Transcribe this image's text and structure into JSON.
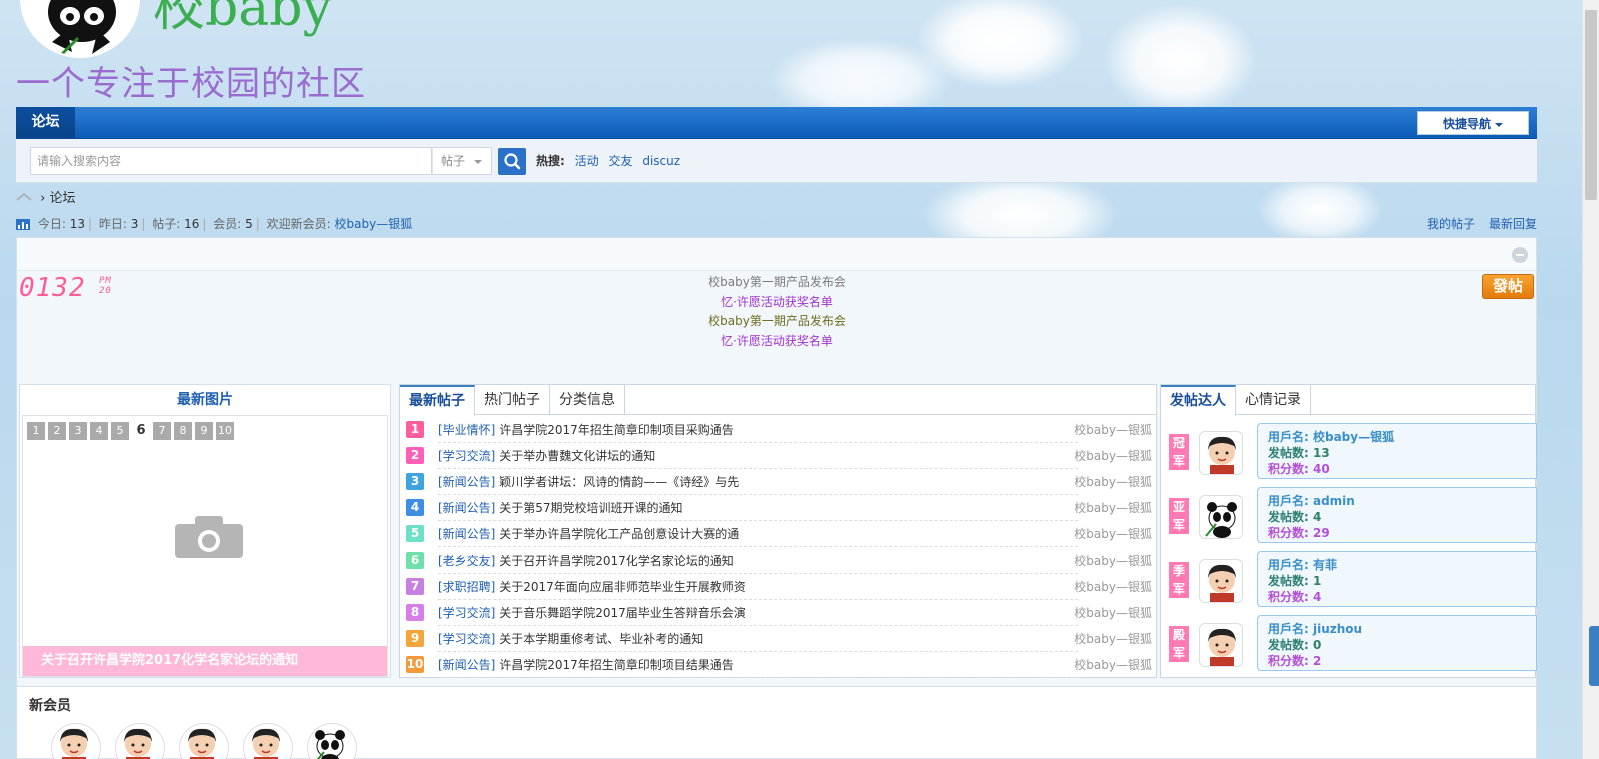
{
  "brand": {
    "logo_text": "校baby",
    "slogan": "一个专注于校园的社区"
  },
  "nav": {
    "forum": "论坛",
    "quick_nav": "快捷导航"
  },
  "search": {
    "placeholder": "请输入搜索内容",
    "type": "帖子",
    "hot_label": "热搜:",
    "hot_tags": [
      "活动",
      "交友",
      "discuz"
    ]
  },
  "breadcrumb": {
    "current": "论坛"
  },
  "stats": {
    "today_label": "今日:",
    "today": "13",
    "yesterday_label": "昨日:",
    "yesterday": "3",
    "posts_label": "帖子:",
    "posts": "16",
    "members_label": "会员:",
    "members": "5",
    "welcome_label": "欢迎新会员:",
    "welcome_user": "校baby—银狐"
  },
  "top_links": {
    "my_posts": "我的帖子",
    "latest_reply": "最新回复"
  },
  "clock": {
    "time": "0132",
    "ampm": "PM",
    "seconds": "20"
  },
  "ticker": [
    "校baby第一期产品发布会",
    "忆·许愿活动获奖名单",
    "校baby第一期产品发布会",
    "忆·许愿活动获奖名单"
  ],
  "post_button": "發帖",
  "pictures": {
    "title": "最新图片",
    "pages": [
      "1",
      "2",
      "3",
      "4",
      "5",
      "6",
      "7",
      "8",
      "9",
      "10"
    ],
    "active_page": "6",
    "caption": "关于召开许昌学院2017化学名家论坛的通知"
  },
  "post_tabs": [
    "最新帖子",
    "热门帖子",
    "分类信息"
  ],
  "posts": [
    {
      "rank": "1",
      "color": "#ff5f9d",
      "cat": "[毕业情怀]",
      "title": "许昌学院2017年招生简章印制项目采购通告",
      "author": "校baby—银狐"
    },
    {
      "rank": "2",
      "color": "#ff5fb8",
      "cat": "[学习交流]",
      "title": "关于举办曹魏文化讲坛的通知",
      "author": "校baby—银狐"
    },
    {
      "rank": "3",
      "color": "#3fa3e0",
      "cat": "[新闻公告]",
      "title": "颖川学者讲坛：风诗的情韵——《诗经》与先",
      "author": "校baby—银狐"
    },
    {
      "rank": "4",
      "color": "#3f8fe0",
      "cat": "[新闻公告]",
      "title": "关于第57期党校培训班开课的通知",
      "author": "校baby—银狐"
    },
    {
      "rank": "5",
      "color": "#6fe0c8",
      "cat": "[新闻公告]",
      "title": "关于举办许昌学院化工产品创意设计大赛的通",
      "author": "校baby—银狐"
    },
    {
      "rank": "6",
      "color": "#6fe0a8",
      "cat": "[老乡交友]",
      "title": "关于召开许昌学院2017化学名家论坛的通知",
      "author": "校baby—银狐"
    },
    {
      "rank": "7",
      "color": "#c77fe0",
      "cat": "[求职招聘]",
      "title": "关于2017年面向应届非师范毕业生开展教师资",
      "author": "校baby—银狐"
    },
    {
      "rank": "8",
      "color": "#d77fe8",
      "cat": "[学习交流]",
      "title": "关于音乐舞蹈学院2017届毕业生答辩音乐会演",
      "author": "校baby—银狐"
    },
    {
      "rank": "9",
      "color": "#f5a53a",
      "cat": "[学习交流]",
      "title": "关于本学期重修考试、毕业补考的通知",
      "author": "校baby—银狐"
    },
    {
      "rank": "10",
      "color": "#f59a3a",
      "cat": "[新闻公告]",
      "title": "许昌学院2017年招生简章印制项目结果通告",
      "author": "校baby—银狐"
    }
  ],
  "rank_tabs": [
    "发帖达人",
    "心情记录"
  ],
  "ranks": [
    {
      "medal": "冠军",
      "name_label": "用戶名:",
      "name": "校baby—银狐",
      "count_label": "发帖数:",
      "count": "13",
      "score_label": "积分数:",
      "score": "40",
      "avatar": "person"
    },
    {
      "medal": "亚军",
      "name_label": "用戶名:",
      "name": "admin",
      "count_label": "发帖数:",
      "count": "4",
      "score_label": "积分数:",
      "score": "29",
      "avatar": "panda"
    },
    {
      "medal": "季军",
      "name_label": "用戶名:",
      "name": "有菲",
      "count_label": "发帖数:",
      "count": "1",
      "score_label": "积分数:",
      "score": "4",
      "avatar": "person"
    },
    {
      "medal": "殿军",
      "name_label": "用戶名:",
      "name": "jiuzhou",
      "count_label": "发帖数:",
      "count": "0",
      "score_label": "积分数:",
      "score": "2",
      "avatar": "person"
    }
  ],
  "new_members": {
    "title": "新会员"
  },
  "colors": {
    "nav_blue": "#0c5bb7",
    "pink": "#ff79b3",
    "link": "#2060b0",
    "orange": "#f0900f"
  }
}
